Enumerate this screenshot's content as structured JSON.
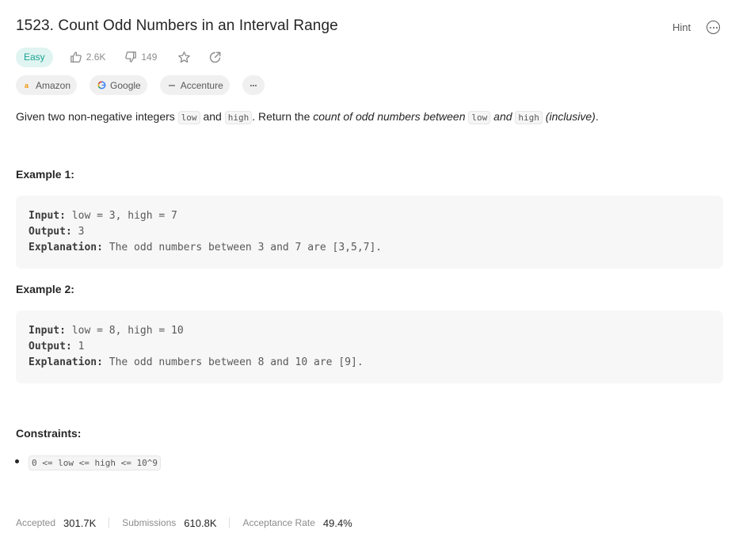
{
  "problem": {
    "title": "1523. Count Odd Numbers in an Interval Range",
    "hint_label": "Hint",
    "difficulty": "Easy",
    "likes": "2.6K",
    "dislikes": "149"
  },
  "tags": [
    "Amazon",
    "Google",
    "Accenture",
    "···"
  ],
  "description": {
    "p1": "Given two non-negative integers ",
    "code_low": "low",
    "p2": " and ",
    "code_high": "high",
    "p3": ". Return the ",
    "em1": "count of odd numbers between ",
    "em2": " and ",
    "em3": " (inclusive)",
    "p4": "."
  },
  "examples": [
    {
      "title": "Example 1:",
      "input_label": "Input:",
      "input": "low = 3, high = 7",
      "output_label": "Output:",
      "output": "3",
      "explanation_label": "Explanation:",
      "explanation": "The odd numbers between 3 and 7 are [3,5,7]."
    },
    {
      "title": "Example 2:",
      "input_label": "Input:",
      "input": "low = 8, high = 10",
      "output_label": "Output:",
      "output": "1",
      "explanation_label": "Explanation:",
      "explanation": "The odd numbers between 8 and 10 are [9]."
    }
  ],
  "constraints": {
    "title": "Constraints:",
    "items": [
      "0 <= low <= high <= 10^9"
    ]
  },
  "stats": {
    "accepted_label": "Accepted",
    "accepted": "301.7K",
    "submissions_label": "Submissions",
    "submissions": "610.8K",
    "rate_label": "Acceptance Rate",
    "rate": "49.4%"
  },
  "colors": {
    "easy": "#1aa292",
    "easy_bg": "#e0f4f1",
    "text": "#262626",
    "muted": "#8c8c8c"
  }
}
